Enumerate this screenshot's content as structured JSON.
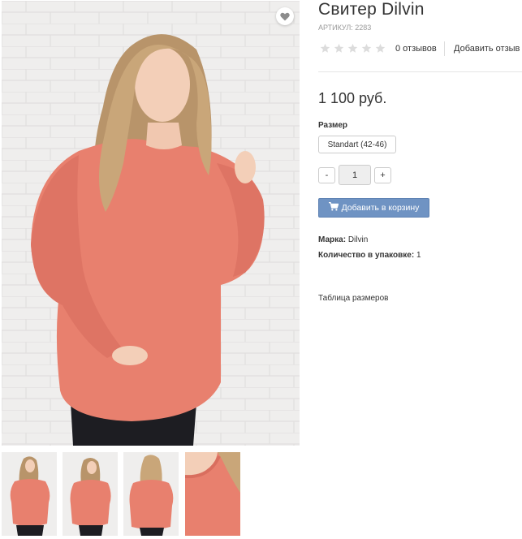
{
  "product": {
    "title": "Свитер Dilvin",
    "sku": "АРТИКУЛ: 2283",
    "rating": {
      "stars_filled": 0,
      "stars_total": 5,
      "reviews": "0 отзывов",
      "add_review": "Добавить отзыв"
    },
    "price": "1 100 руб.",
    "size_label": "Размер",
    "size_option": "Standart (42-46)",
    "quantity": {
      "minus": "-",
      "value": "1",
      "plus": "+"
    },
    "add_to_cart": "Добавить в корзину",
    "specs": {
      "brand_label": "Марка:",
      "brand_value": "Dilvin",
      "pack_label": "Количество в упаковке:",
      "pack_value": "1"
    },
    "size_table": "Таблица размеров"
  },
  "gallery": {
    "wishlist_icon": "heart-icon",
    "thumbnails": [
      "front-view",
      "side-view",
      "back-view",
      "detail-closeup"
    ]
  },
  "colors": {
    "sweater": "#e8806e",
    "cart_button": "#6f93c3",
    "star_empty": "#dcdcdc"
  }
}
